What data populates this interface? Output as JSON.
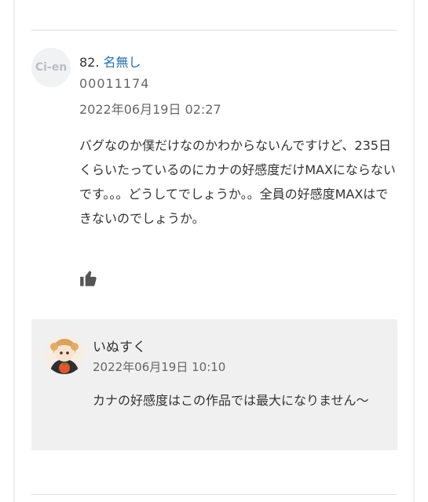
{
  "comment": {
    "avatar_text": "Ci-en",
    "number": "82.",
    "name": "名無し",
    "user_id": "00011174",
    "date": "2022年06月19日 02:27",
    "body": "バグなのか僕だけなのかわからないんですけど、235日くらいたっているのにカナの好感度だけMAXにならないです。。。どうしてでしょうか。。全員の好感度MAXはできないのでしょうか。",
    "like_icon": "thumbs-up-icon"
  },
  "reply": {
    "avatar_icon": "author-avatar",
    "name": "いぬすく",
    "date": "2022年06月19日 10:10",
    "body": "カナの好感度はこの作品では最大になりません〜"
  }
}
